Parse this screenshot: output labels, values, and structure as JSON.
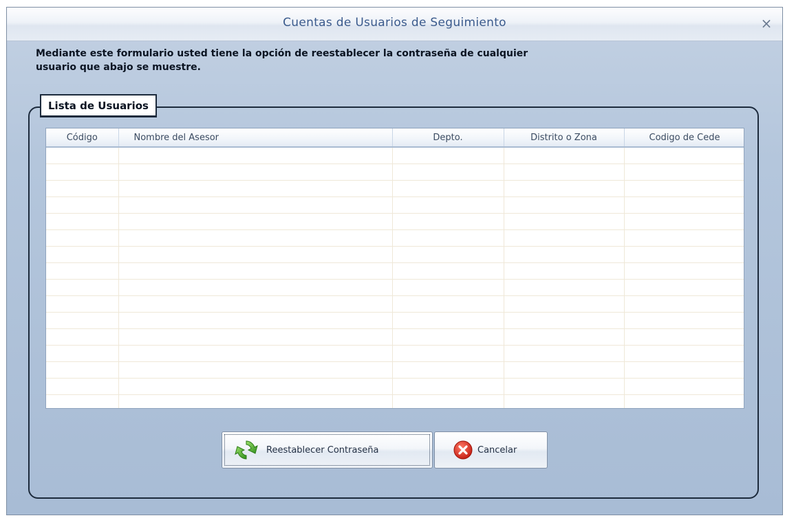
{
  "window": {
    "title": "Cuentas de Usuarios de Seguimiento",
    "close_label": "×"
  },
  "description": {
    "line1": "Mediante este formulario usted tiene la opción de reestablecer la contraseña de cualquier",
    "line2": "usuario que abajo se muestre."
  },
  "group": {
    "label": "Lista de Usuarios"
  },
  "table": {
    "columns": [
      "Código",
      "Nombre del Asesor",
      "Depto.",
      "Distrito o Zona",
      "Codigo de Cede"
    ],
    "rows": []
  },
  "buttons": {
    "reset_label": "Reestablecer Contraseña",
    "cancel_label": "Cancelar"
  },
  "icons": {
    "refresh": "refresh-icon",
    "cancel": "cancel-icon",
    "close": "close-icon"
  },
  "colors": {
    "window_bg": "#b4c6dc",
    "title_text": "#3a5a8c",
    "grid_line": "#efe8d8",
    "cancel_red": "#d42a1c",
    "refresh_green": "#4aaa2a"
  }
}
